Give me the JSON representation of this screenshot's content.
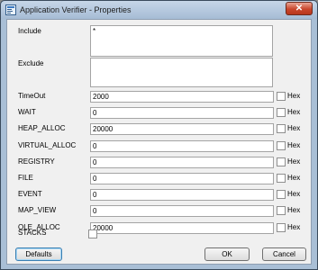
{
  "window": {
    "title": "Application Verifier - Properties",
    "close_glyph": "✕"
  },
  "fields": {
    "include": {
      "label": "Include",
      "value": "*"
    },
    "exclude": {
      "label": "Exclude",
      "value": ""
    }
  },
  "rows": [
    {
      "label": "TimeOut",
      "value": "2000",
      "hex_label": "Hex",
      "hex_checked": false
    },
    {
      "label": "WAIT",
      "value": "0",
      "hex_label": "Hex",
      "hex_checked": false
    },
    {
      "label": "HEAP_ALLOC",
      "value": "20000",
      "hex_label": "Hex",
      "hex_checked": false
    },
    {
      "label": "VIRTUAL_ALLOC",
      "value": "0",
      "hex_label": "Hex",
      "hex_checked": false
    },
    {
      "label": "REGISTRY",
      "value": "0",
      "hex_label": "Hex",
      "hex_checked": false
    },
    {
      "label": "FILE",
      "value": "0",
      "hex_label": "Hex",
      "hex_checked": false
    },
    {
      "label": "EVENT",
      "value": "0",
      "hex_label": "Hex",
      "hex_checked": false
    },
    {
      "label": "MAP_VIEW",
      "value": "0",
      "hex_label": "Hex",
      "hex_checked": false
    },
    {
      "label": "OLE_ALLOC",
      "value": "20000",
      "hex_label": "Hex",
      "hex_checked": false
    }
  ],
  "stacks": {
    "label": "STACKS",
    "checked": false
  },
  "buttons": {
    "defaults": "Defaults",
    "ok": "OK",
    "cancel": "Cancel"
  },
  "icons": [
    "app-icon",
    "close-icon"
  ]
}
